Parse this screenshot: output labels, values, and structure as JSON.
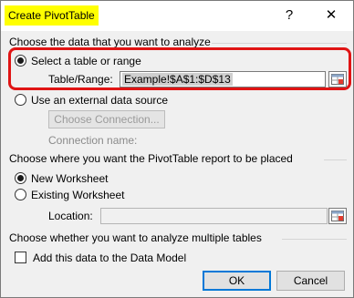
{
  "window": {
    "title": "Create PivotTable",
    "help_glyph": "?",
    "close_glyph": "✕"
  },
  "data_source": {
    "heading": "Choose the data that you want to analyze",
    "select_table_label": "Select a table or range",
    "select_table_checked": true,
    "table_range_label": "Table/Range:",
    "table_range_value": "Example!$A$1:$D$13",
    "external_label": "Use an external data source",
    "external_checked": false,
    "choose_connection_label": "Choose Connection...",
    "connection_name_label": "Connection name:"
  },
  "placement": {
    "heading": "Choose where you want the PivotTable report to be placed",
    "new_worksheet_label": "New Worksheet",
    "new_worksheet_checked": true,
    "existing_worksheet_label": "Existing Worksheet",
    "existing_worksheet_checked": false,
    "location_label": "Location:",
    "location_value": ""
  },
  "multiple_tables": {
    "heading": "Choose whether you want to analyze multiple tables",
    "data_model_label": "Add this data to the Data Model",
    "data_model_checked": false
  },
  "buttons": {
    "ok_label": "OK",
    "cancel_label": "Cancel"
  },
  "colors": {
    "title_highlight": "#ffff00",
    "annotation_box": "#e01414",
    "default_button_border": "#0078d7"
  },
  "icons": {
    "range_picker": "collapse-dialog-icon"
  }
}
